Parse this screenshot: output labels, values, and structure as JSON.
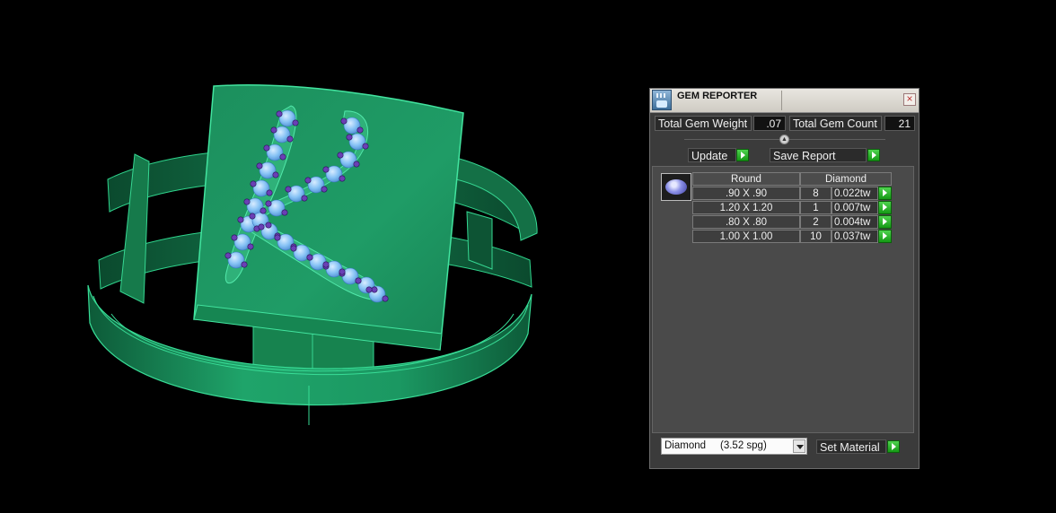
{
  "panel": {
    "title": "GEM REPORTER",
    "close_icon": "close-icon",
    "total_gem_weight_label": "Total Gem Weight",
    "total_gem_weight_value": ".07",
    "total_gem_count_label": "Total Gem Count",
    "total_gem_count_value": "21",
    "update_label": "Update",
    "save_report_label": "Save Report",
    "table": {
      "cut": "Round",
      "material": "Diamond",
      "rows": [
        {
          "size": ".90 X .90",
          "count": "8",
          "weight": "0.022tw"
        },
        {
          "size": "1.20 X 1.20",
          "count": "1",
          "weight": "0.007tw"
        },
        {
          "size": ".80 X .80",
          "count": "2",
          "weight": "0.004tw"
        },
        {
          "size": "1.00 X 1.00",
          "count": "10",
          "weight": "0.037tw"
        }
      ]
    },
    "material_select_value": "Diamond     (3.52 spg)",
    "set_material_label": "Set Material"
  },
  "colors": {
    "ring_green": "#1f9a63",
    "gem_blue": "#7fbcf2",
    "prong_purple": "#6a3fb5",
    "go_green": "#2db52d"
  }
}
